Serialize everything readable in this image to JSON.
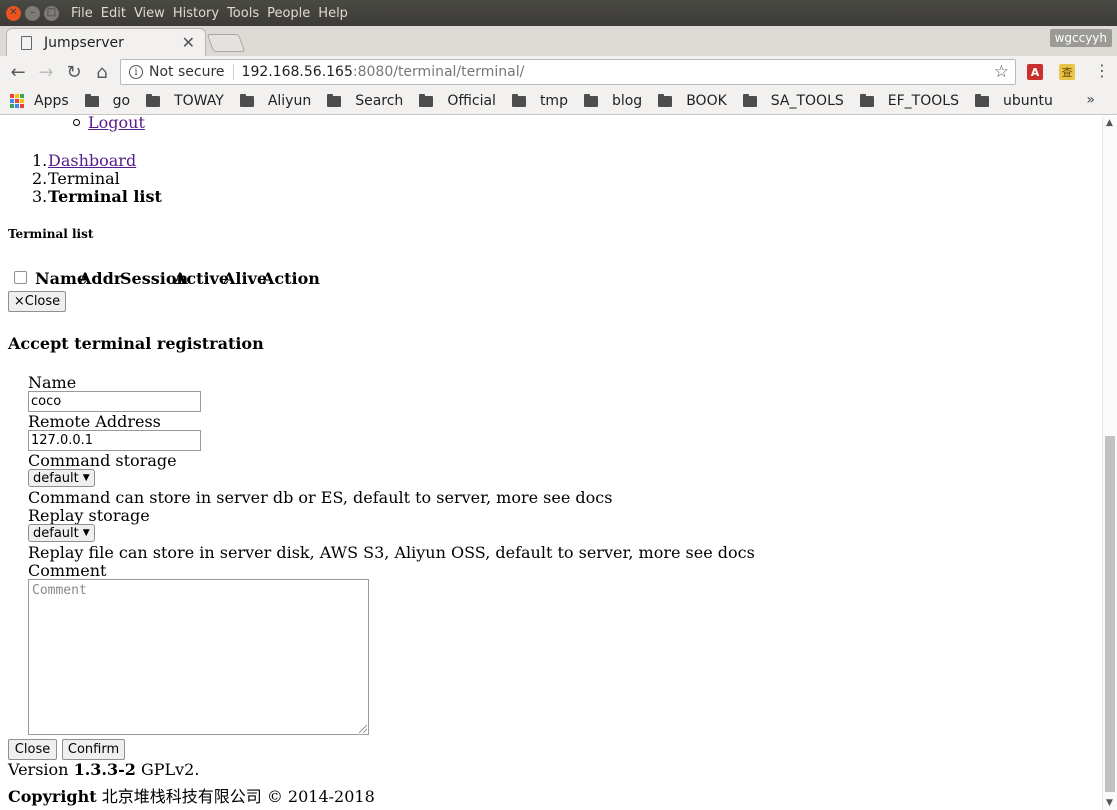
{
  "os": {
    "menus": [
      "File",
      "Edit",
      "View",
      "History",
      "Tools",
      "People",
      "Help"
    ]
  },
  "browser": {
    "tab_title": "Jumpserver",
    "profile": "wgccyyh",
    "security": "Not secure",
    "url_host": "192.168.56.165",
    "url_rest": ":8080/terminal/terminal/",
    "bookmarks": {
      "apps_label": "Apps",
      "items": [
        "go",
        "TOWAY",
        "Aliyun",
        "Search",
        "Official",
        "tmp",
        "blog",
        "BOOK",
        "SA_TOOLS",
        "EF_TOOLS",
        "ubuntu"
      ]
    }
  },
  "page": {
    "logout": "Logout",
    "breadcrumb": {
      "items": [
        {
          "num": "1.",
          "label": "Dashboard"
        },
        {
          "num": "2.",
          "label": "Terminal"
        },
        {
          "num": "3.",
          "label": "Terminal list"
        }
      ]
    },
    "section_title": "Terminal list",
    "table_headers": [
      "Name",
      "Addr",
      "Session",
      "Active",
      "Alive",
      "Action"
    ],
    "close_x_label": "×Close",
    "modal": {
      "title": "Accept terminal registration",
      "name_label": "Name",
      "name_value": "coco",
      "remote_label": "Remote Address",
      "remote_value": "127.0.0.1",
      "command_label": "Command storage",
      "command_value": "default",
      "command_help": "Command can store in server db or ES, default to server, more see docs",
      "replay_label": "Replay storage",
      "replay_value": "default",
      "replay_help": "Replay file can store in server disk, AWS S3, Aliyun OSS, default to server, more see docs",
      "comment_label": "Comment",
      "comment_placeholder": "Comment",
      "close_button": "Close",
      "confirm_button": "Confirm"
    },
    "footer": {
      "version_prefix": "Version",
      "version": "1.3.3-2",
      "license": "GPLv2.",
      "copyright_label": "Copyright",
      "company": "北京堆栈科技有限公司",
      "years": "© 2014-2018"
    }
  }
}
